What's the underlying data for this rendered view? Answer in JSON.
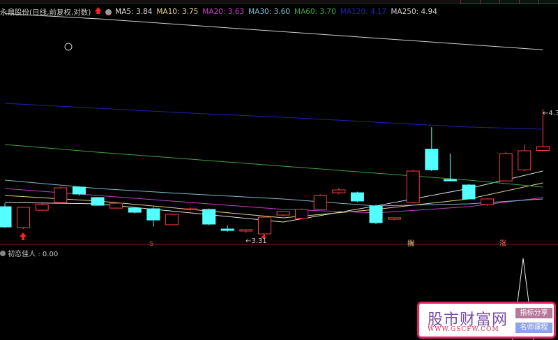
{
  "header": {
    "stock": "永鼎股份(日线,前复权,对数)"
  },
  "ma": [
    {
      "label": "MA5: 3.84",
      "color": "#e0e0e0",
      "pts": [
        3.597,
        3.586,
        3.516,
        3.445,
        3.57,
        3.705,
        3.84
      ]
    },
    {
      "label": "MA10: 3.75",
      "color": "#e6d28a",
      "pts": [
        3.651,
        3.608,
        3.543,
        3.478,
        3.543,
        3.624,
        3.748
      ]
    },
    {
      "label": "MA20: 3.63",
      "color": "#c040c0",
      "pts": [
        3.705,
        3.651,
        3.597,
        3.543,
        3.516,
        3.564,
        3.635
      ]
    },
    {
      "label": "MA30: 3.60",
      "color": "#7fb8c8",
      "pts": [
        3.77,
        3.705,
        3.662,
        3.624,
        3.57,
        3.586,
        3.624
      ]
    },
    {
      "label": "MA60: 3.70",
      "color": "#40a040",
      "pts": [
        4.046,
        3.986,
        3.932,
        3.878,
        3.824,
        3.77,
        3.716
      ]
    },
    {
      "label": "MA120: 4.17",
      "color": "#2020b0",
      "pts": [
        4.365,
        4.327,
        4.289,
        4.257,
        4.219,
        4.181,
        4.165
      ]
    },
    {
      "label": "MA250: 4.94",
      "color": "#d0d0d0",
      "pts": [
        5.06,
        5.02,
        4.97,
        4.92,
        4.87,
        4.82,
        4.78
      ]
    }
  ],
  "candles": [
    [
      3.564,
      3.407,
      3.59,
      3.4
    ],
    [
      3.402,
      3.559,
      3.56,
      3.39
    ],
    [
      3.537,
      3.58,
      3.59,
      3.53
    ],
    [
      3.597,
      3.71,
      3.72,
      3.59
    ],
    [
      3.716,
      3.662,
      3.72,
      3.65
    ],
    [
      3.635,
      3.575,
      3.64,
      3.57
    ],
    [
      3.553,
      3.591,
      3.6,
      3.55
    ],
    [
      3.553,
      3.521,
      3.56,
      3.51
    ],
    [
      3.548,
      3.461,
      3.56,
      3.41
    ],
    [
      3.424,
      3.505,
      3.51,
      3.42
    ],
    [
      3.543,
      3.548,
      3.56,
      3.53
    ],
    [
      3.543,
      3.429,
      3.55,
      3.42
    ],
    [
      3.391,
      3.38,
      3.42,
      3.37
    ],
    [
      3.375,
      3.386,
      3.39,
      3.36
    ],
    [
      3.353,
      3.483,
      3.49,
      3.31
    ],
    [
      3.499,
      3.526,
      3.53,
      3.49
    ],
    [
      3.472,
      3.543,
      3.55,
      3.47
    ],
    [
      3.543,
      3.651,
      3.66,
      3.54
    ],
    [
      3.672,
      3.694,
      3.71,
      3.66
    ],
    [
      3.672,
      3.608,
      3.68,
      3.6
    ],
    [
      3.57,
      3.44,
      3.58,
      3.43
    ],
    [
      3.467,
      3.478,
      3.48,
      3.46
    ],
    [
      3.597,
      3.84,
      3.85,
      3.59
    ],
    [
      4.01,
      3.85,
      4.18,
      3.84
    ],
    [
      3.775,
      3.764,
      3.975,
      3.76
    ],
    [
      3.732,
      3.624,
      3.74,
      3.62
    ],
    [
      3.58,
      3.624,
      3.63,
      3.57
    ],
    [
      3.764,
      3.975,
      3.99,
      3.76
    ],
    [
      3.85,
      3.997,
      4.046,
      3.84
    ],
    [
      4.0,
      4.03,
      4.32,
      3.99
    ]
  ],
  "annotations": {
    "low": "3.31",
    "high": "4.3",
    "s_mark": "S",
    "sig1": "揣",
    "sig2": "涨"
  },
  "indicator": {
    "label": "初恋佳人 : 0.00"
  },
  "watermark": {
    "title": "股市财富网",
    "url": "WWW.GSCFW.COM",
    "btn1": "指标分享",
    "btn2": "名师课程"
  },
  "colors": {
    "up": "#ff4040",
    "down": "#54ffff"
  }
}
